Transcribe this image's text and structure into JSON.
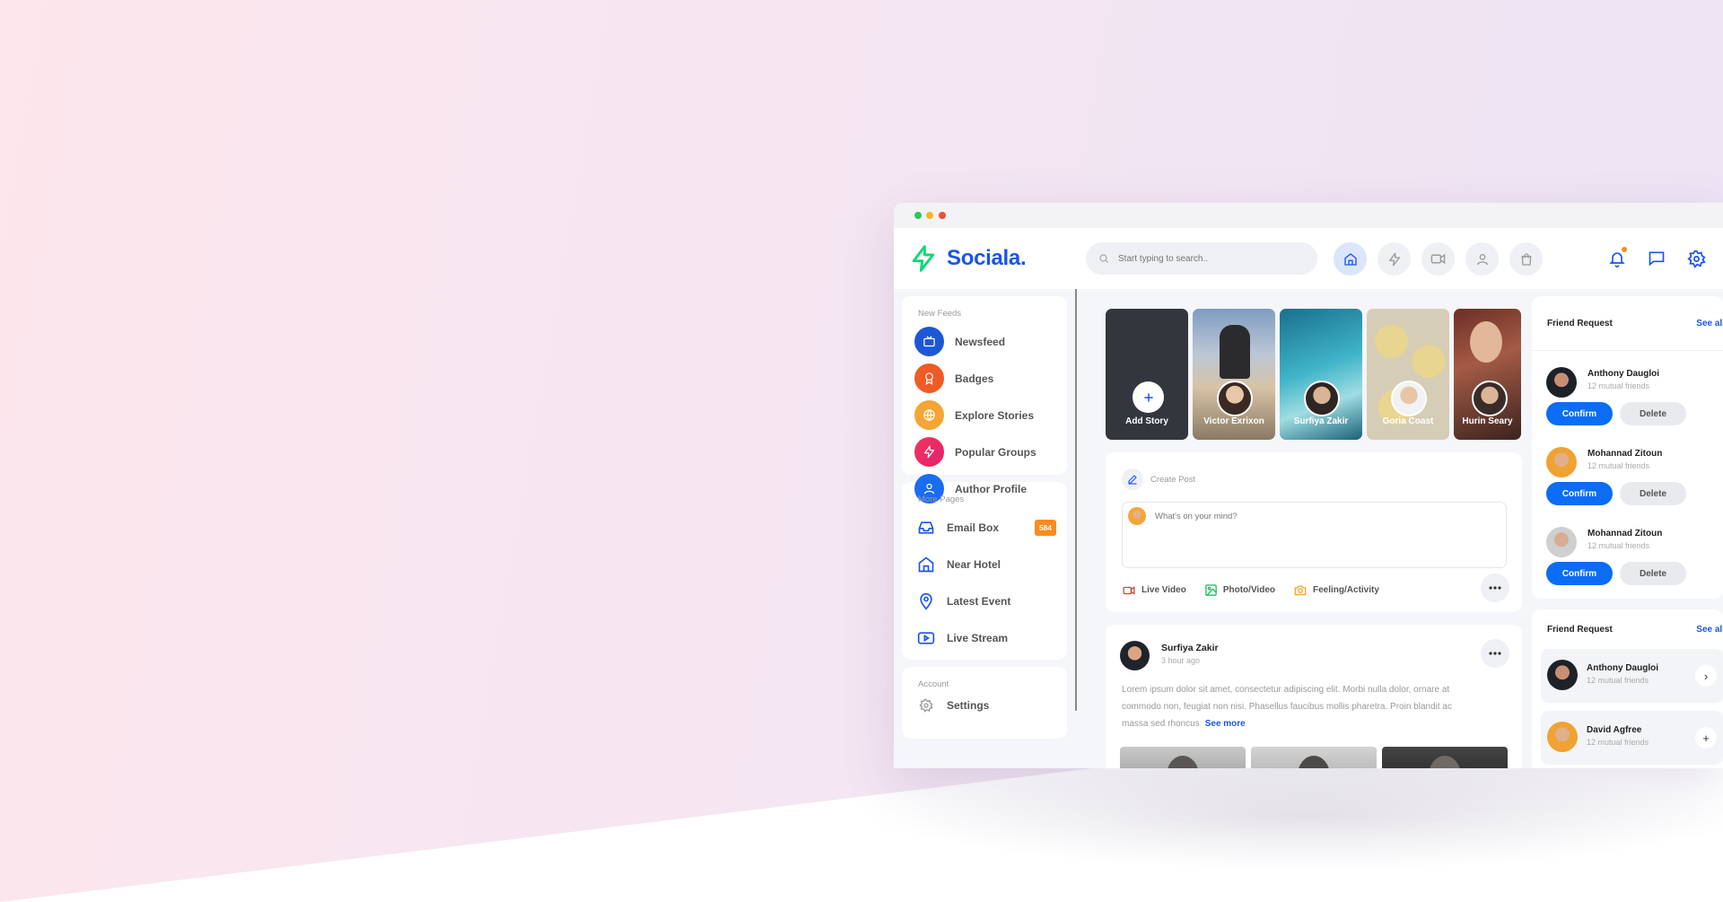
{
  "app": {
    "name": "Sociala."
  },
  "search": {
    "placeholder": "Start typing to search.."
  },
  "top_nav": [
    "home-icon",
    "bolt-icon",
    "video-icon",
    "user-icon",
    "shopping-bag-icon"
  ],
  "sidebar": {
    "new_feeds_title": "New Feeds",
    "feeds": [
      {
        "label": "Newsfeed",
        "icon": "tv-icon",
        "color": "#1e57d6"
      },
      {
        "label": "Badges",
        "icon": "award-icon",
        "color": "#f05a24"
      },
      {
        "label": "Explore Stories",
        "icon": "globe-icon",
        "color": "#f5a534"
      },
      {
        "label": "Popular Groups",
        "icon": "bolt-icon",
        "color": "#ee2c5c"
      },
      {
        "label": "Author Profile",
        "icon": "user-icon",
        "color": "#1a6cf3"
      }
    ],
    "more_pages_title": "More Pages",
    "pages": [
      {
        "label": "Email Box",
        "icon": "inbox-icon",
        "badge": "584"
      },
      {
        "label": "Near Hotel",
        "icon": "home-icon"
      },
      {
        "label": "Latest Event",
        "icon": "map-pin-icon"
      },
      {
        "label": "Live Stream",
        "icon": "youtube-icon"
      }
    ],
    "account_title": "Account",
    "settings_label": "Settings"
  },
  "stories": [
    {
      "name": "Add Story"
    },
    {
      "name": "Victor Exrixon"
    },
    {
      "name": "Surfiya Zakir"
    },
    {
      "name": "Goria Coast"
    },
    {
      "name": "Hurin Seary"
    }
  ],
  "create_post": {
    "title": "Create Post",
    "placeholder": "What's on your mind?",
    "actions": [
      "Live Video",
      "Photo/Video",
      "Feeling/Activity"
    ]
  },
  "post": {
    "author": "Surfiya Zakir",
    "time": "3 hour ago",
    "text": "Lorem ipsum dolor sit amet, consectetur adipiscing elit. Morbi nulla dolor, ornare at commodo non, feugiat non nisi. Phasellus faucibus mollis pharetra. Proin blandit ac massa sed rhoncus",
    "see_more": "See more"
  },
  "friend_requests": {
    "title": "Friend Request",
    "see_all": "See all",
    "confirm_label": "Confirm",
    "delete_label": "Delete",
    "items": [
      {
        "name": "Anthony Daugloi",
        "mutual": "12 mutual friends"
      },
      {
        "name": "Mohannad Zitoun",
        "mutual": "12 mutual friends"
      },
      {
        "name": "Mohannad Zitoun",
        "mutual": "12 mutual friends"
      }
    ]
  },
  "friend_requests_2": {
    "title": "Friend Request",
    "see_all": "See all",
    "items": [
      {
        "name": "Anthony Daugloi",
        "mutual": "12 mutual friends",
        "action": "›"
      },
      {
        "name": "David Agfree",
        "mutual": "12 mutual friends",
        "action": "+"
      }
    ]
  }
}
